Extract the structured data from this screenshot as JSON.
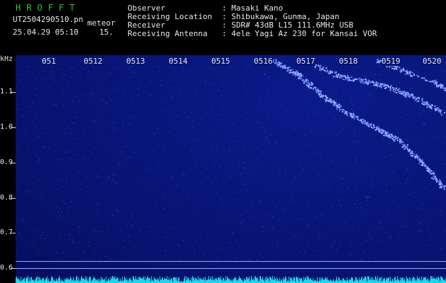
{
  "app": {
    "title": "HROFFT"
  },
  "file": {
    "name": "UT2504290510.pn",
    "type": "meteor",
    "datetime": "25.04.29 05:10",
    "interval": "15."
  },
  "info": {
    "observer_label": "Observer",
    "observer_value": ": Masaki Kano",
    "location_label": "Receiving Location",
    "location_value": ": Shibukawa, Gunma, Japan",
    "receiver_label": "Receiver",
    "receiver_value": ": SDR# 43dB L15 111.6MHz USB",
    "antenna_label": "Receiving Antenna",
    "antenna_value": ": 4ele Yagi Az 230 for Kansai VOR"
  },
  "axis": {
    "unit": "kHz",
    "y_ticks": [
      "1.1",
      "1.0",
      "0.9",
      "0.8",
      "0.7",
      "0.6"
    ],
    "x_ticks": [
      "051",
      "0512",
      "0513",
      "0514",
      "0515",
      "0516",
      "0517",
      "0518",
      "0519",
      "0520"
    ]
  },
  "colors": {
    "background": "#071473",
    "trace": "#6f8cff",
    "title": "#2ccb2c"
  }
}
